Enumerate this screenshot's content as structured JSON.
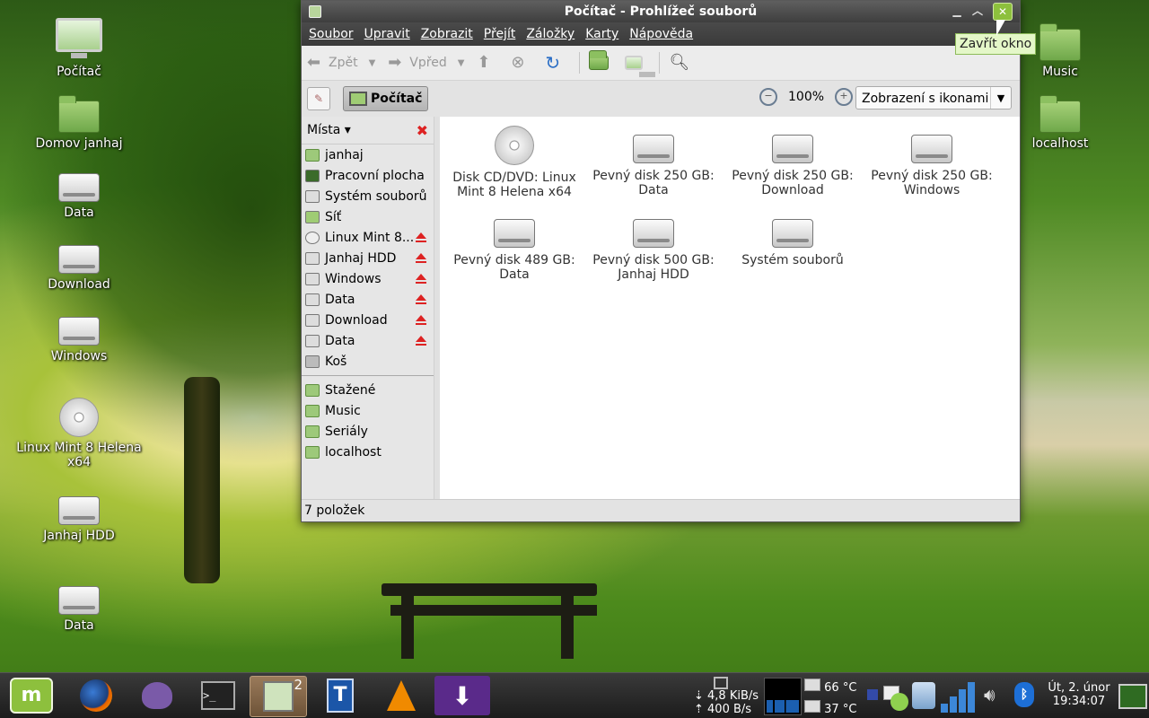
{
  "desktop": {
    "icons_left": [
      "Počítač",
      "Domov janhaj",
      "Data",
      "Download",
      "Windows",
      "Linux Mint 8 Helena x64",
      "Janhaj HDD",
      "Data"
    ],
    "icons_right": [
      "Music",
      "localhost"
    ]
  },
  "window": {
    "title": "Počítač - Prohlížeč souborů",
    "menu": [
      "Soubor",
      "Upravit",
      "Zobrazit",
      "Přejít",
      "Záložky",
      "Karty",
      "Nápověda"
    ],
    "toolbar": {
      "back": "Zpět",
      "forward": "Vpřed"
    },
    "location": {
      "path_button": "Počítač",
      "zoom": "100%",
      "view_mode": "Zobrazení s ikonami"
    },
    "sidebar": {
      "header": "Místa",
      "places": [
        {
          "label": "janhaj",
          "eject": false
        },
        {
          "label": "Pracovní plocha",
          "eject": false
        },
        {
          "label": "Systém souborů",
          "eject": false
        },
        {
          "label": "Síť",
          "eject": false
        },
        {
          "label": "Linux Mint 8...",
          "eject": true
        },
        {
          "label": "Janhaj HDD",
          "eject": true
        },
        {
          "label": "Windows",
          "eject": true
        },
        {
          "label": "Data",
          "eject": true
        },
        {
          "label": "Download",
          "eject": true
        },
        {
          "label": "Data",
          "eject": true
        },
        {
          "label": "Koš",
          "eject": false
        }
      ],
      "bookmarks": [
        "Stažené",
        "Music",
        "Seriály",
        "localhost"
      ]
    },
    "files": [
      {
        "label": "Disk CD/DVD: Linux Mint 8 Helena x64",
        "icon": "disc-icon"
      },
      {
        "label": "Pevný disk 250 GB: Data",
        "icon": "drive-icon"
      },
      {
        "label": "Pevný disk 250 GB: Download",
        "icon": "drive-icon"
      },
      {
        "label": "Pevný disk 250 GB: Windows",
        "icon": "drive-icon"
      },
      {
        "label": "Pevný disk 489 GB: Data",
        "icon": "drive-icon"
      },
      {
        "label": "Pevný disk 500 GB: Janhaj HDD",
        "icon": "drive-icon"
      },
      {
        "label": "Systém souborů",
        "icon": "drive-icon"
      }
    ],
    "status": "7 položek",
    "tooltip": "Zavřít okno"
  },
  "taskbar": {
    "file_manager_badge": "2",
    "net_down": "4,8 KiB/s",
    "net_up": "400 B/s",
    "temp1": "66 °C",
    "temp2": "37 °C",
    "date": "Út,  2. únor",
    "time": "19:34:07"
  },
  "colors": {
    "accent": "#8dc03d",
    "eject": "#d22222"
  }
}
